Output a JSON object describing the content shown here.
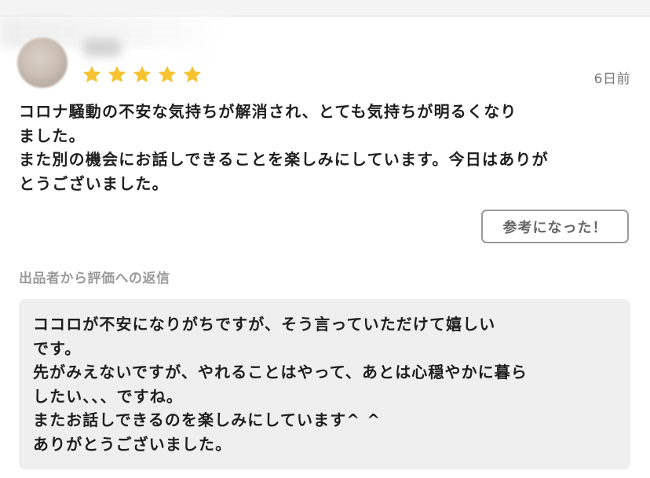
{
  "review": {
    "rating": 5,
    "max_rating": 5,
    "time_ago": "6日前",
    "text": "コロナ騒動の不安な気持ちが解消され、とても気持ちが明るくなり\nました。\nまた別の機会にお話しできることを楽しみにしています。今日はありが\nとうございました。",
    "helpful_button": "参考になった！"
  },
  "reply": {
    "label": "出品者から評価への返信",
    "text": "ココロが不安になりがちですが、そう言っていただけて嬉しい\nです。\n先がみえないですが、やれることはやって、あとは心穏やかに暮ら\nしたい、、、ですね。\nまたお話しできるのを楽しみにしています^ ^\nありがとうございました。"
  },
  "colors": {
    "star": "#f5c230",
    "muted_text": "#7a7a7a",
    "reply_bg": "#efefef"
  },
  "icons": {
    "star": "star-icon",
    "avatar": "user-avatar"
  }
}
